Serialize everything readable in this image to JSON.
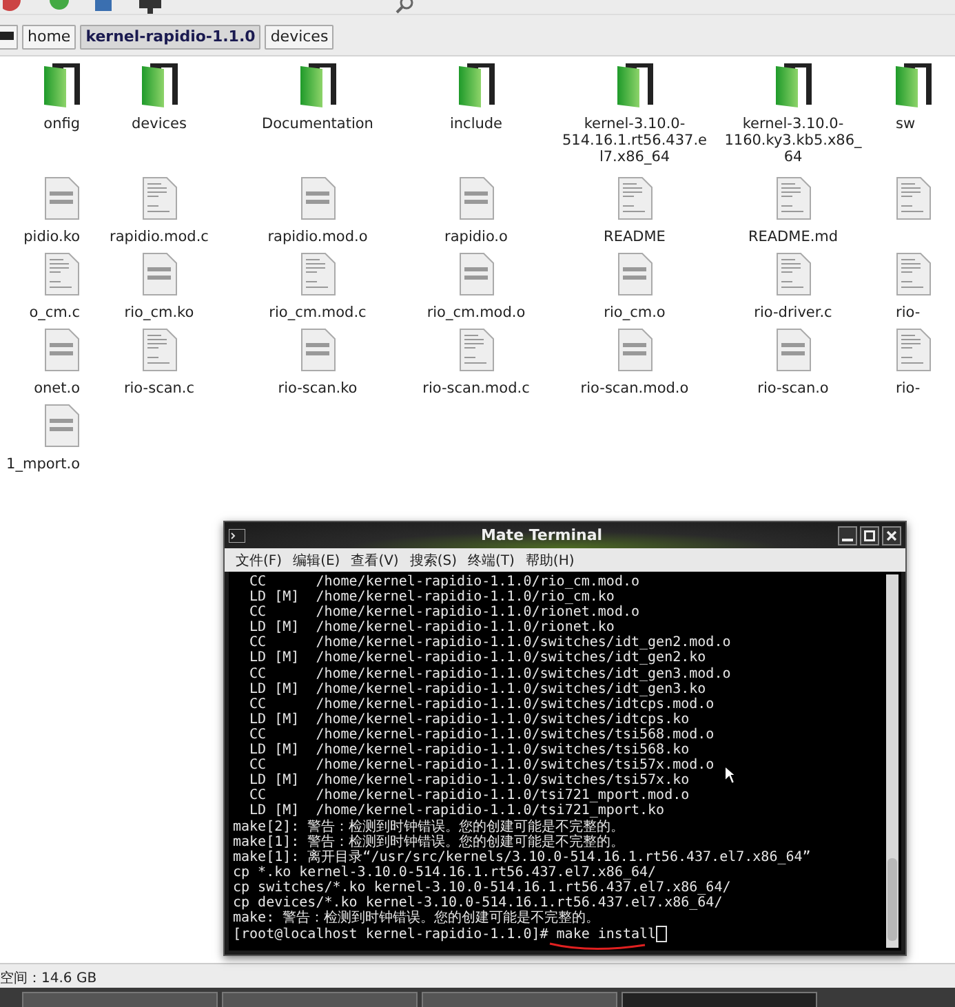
{
  "path_bar": {
    "buttons": [
      {
        "label": "home",
        "selected": false
      },
      {
        "label": "kernel-rapidio-1.1.0",
        "selected": true
      },
      {
        "label": "devices",
        "selected": false
      }
    ]
  },
  "file_rows": [
    [
      {
        "name": "onfig",
        "kind": "folder"
      },
      {
        "name": "devices",
        "kind": "folder"
      },
      {
        "name": "Documentation",
        "kind": "folder"
      },
      {
        "name": "include",
        "kind": "folder"
      },
      {
        "name": "kernel-3.10.0-514.16.1.rt56.437.el7.x86_64",
        "kind": "folder"
      },
      {
        "name": "kernel-3.10.0-1160.ky3.kb5.x86_64",
        "kind": "folder"
      },
      {
        "name": "sw",
        "kind": "folder"
      }
    ],
    [
      {
        "name": "pidio.ko",
        "kind": "binary"
      },
      {
        "name": "rapidio.mod.c",
        "kind": "source"
      },
      {
        "name": "rapidio.mod.o",
        "kind": "binary"
      },
      {
        "name": "rapidio.o",
        "kind": "binary"
      },
      {
        "name": "README",
        "kind": "source"
      },
      {
        "name": "README.md",
        "kind": "source"
      },
      {
        "kind": "source"
      }
    ],
    [
      {
        "name": "o_cm.c",
        "kind": "source"
      },
      {
        "name": "rio_cm.ko",
        "kind": "binary"
      },
      {
        "name": "rio_cm.mod.c",
        "kind": "source"
      },
      {
        "name": "rio_cm.mod.o",
        "kind": "binary"
      },
      {
        "name": "rio_cm.o",
        "kind": "binary"
      },
      {
        "name": "rio-driver.c",
        "kind": "source"
      },
      {
        "name": "rio-",
        "kind": "source"
      }
    ],
    [
      {
        "name": "onet.o",
        "kind": "binary"
      },
      {
        "name": "rio-scan.c",
        "kind": "source"
      },
      {
        "name": "rio-scan.ko",
        "kind": "binary"
      },
      {
        "name": "rio-scan.mod.c",
        "kind": "source"
      },
      {
        "name": "rio-scan.mod.o",
        "kind": "binary"
      },
      {
        "name": "rio-scan.o",
        "kind": "binary"
      },
      {
        "name": "rio-",
        "kind": "source"
      }
    ],
    [
      {
        "name": "1_mport.o",
        "kind": "binary"
      }
    ]
  ],
  "terminal": {
    "title": "Mate Terminal",
    "menu": [
      "文件(F)",
      "编辑(E)",
      "查看(V)",
      "搜索(S)",
      "终端(T)",
      "帮助(H)"
    ],
    "lines": [
      "  CC      /home/kernel-rapidio-1.1.0/rio_cm.mod.o",
      "  LD [M]  /home/kernel-rapidio-1.1.0/rio_cm.ko",
      "  CC      /home/kernel-rapidio-1.1.0/rionet.mod.o",
      "  LD [M]  /home/kernel-rapidio-1.1.0/rionet.ko",
      "  CC      /home/kernel-rapidio-1.1.0/switches/idt_gen2.mod.o",
      "  LD [M]  /home/kernel-rapidio-1.1.0/switches/idt_gen2.ko",
      "  CC      /home/kernel-rapidio-1.1.0/switches/idt_gen3.mod.o",
      "  LD [M]  /home/kernel-rapidio-1.1.0/switches/idt_gen3.ko",
      "  CC      /home/kernel-rapidio-1.1.0/switches/idtcps.mod.o",
      "  LD [M]  /home/kernel-rapidio-1.1.0/switches/idtcps.ko",
      "  CC      /home/kernel-rapidio-1.1.0/switches/tsi568.mod.o",
      "  LD [M]  /home/kernel-rapidio-1.1.0/switches/tsi568.ko",
      "  CC      /home/kernel-rapidio-1.1.0/switches/tsi57x.mod.o",
      "  LD [M]  /home/kernel-rapidio-1.1.0/switches/tsi57x.ko",
      "  CC      /home/kernel-rapidio-1.1.0/tsi721_mport.mod.o",
      "  LD [M]  /home/kernel-rapidio-1.1.0/tsi721_mport.ko",
      "make[2]: 警告：检测到时钟错误。您的创建可能是不完整的。",
      "make[1]: 警告：检测到时钟错误。您的创建可能是不完整的。",
      "make[1]: 离开目录“/usr/src/kernels/3.10.0-514.16.1.rt56.437.el7.x86_64”",
      "cp *.ko kernel-3.10.0-514.16.1.rt56.437.el7.x86_64/",
      "cp switches/*.ko kernel-3.10.0-514.16.1.rt56.437.el7.x86_64/",
      "cp devices/*.ko kernel-3.10.0-514.16.1.rt56.437.el7.x86_64/",
      "make: 警告：检测到时钟错误。您的创建可能是不完整的。"
    ],
    "prompt": "[root@localhost kernel-rapidio-1.1.0]#",
    "command": "make install"
  },
  "status_bar": {
    "text": "空间：14.6 GB"
  }
}
